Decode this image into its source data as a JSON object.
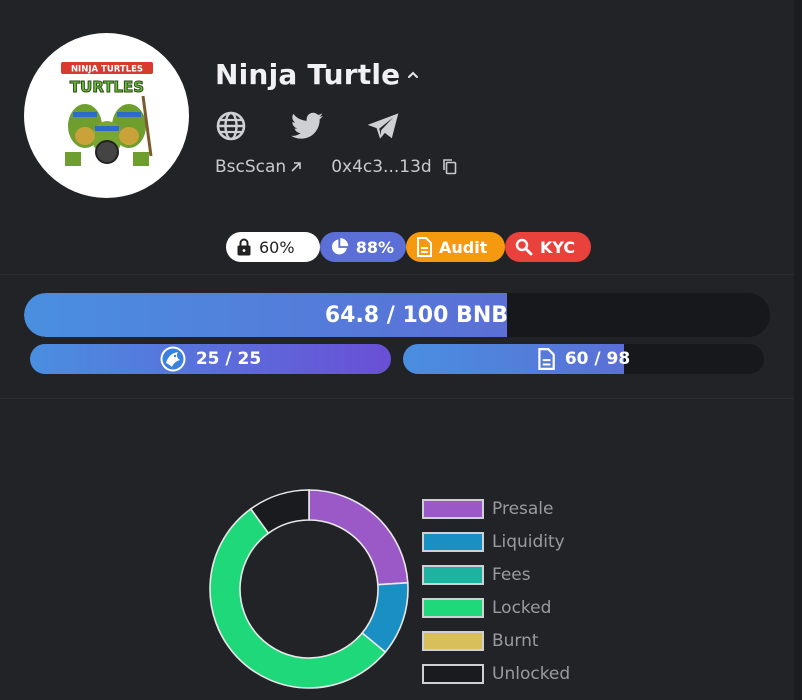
{
  "project": {
    "name": "Ninja Turtle",
    "logo_text_top": "NINJA TURTLES",
    "logo_text_main": "TURTLES",
    "bscscan_label": "BscScan",
    "address_short": "0x4c3...13d"
  },
  "badges": {
    "lock_pct": "60%",
    "pie_pct": "88%",
    "audit_label": "Audit",
    "kyc_label": "KYC"
  },
  "progress": {
    "main_label": "64.8 / 100 BNB",
    "main_fraction": 0.648,
    "contributors_label": "25 / 25",
    "contributors_fraction": 1.0,
    "whitelist_label": "60 / 98",
    "whitelist_fraction": 0.612
  },
  "chart_data": {
    "type": "pie",
    "categories": [
      "Presale",
      "Liquidity",
      "Fees",
      "Locked",
      "Burnt",
      "Unlocked"
    ],
    "values": [
      24,
      12,
      0,
      54,
      0,
      10
    ],
    "colors": [
      "#9b59c8",
      "#1a8fc4",
      "#20b2a0",
      "#1fd87a",
      "#d8bf5c",
      "#1a1b1e"
    ]
  }
}
